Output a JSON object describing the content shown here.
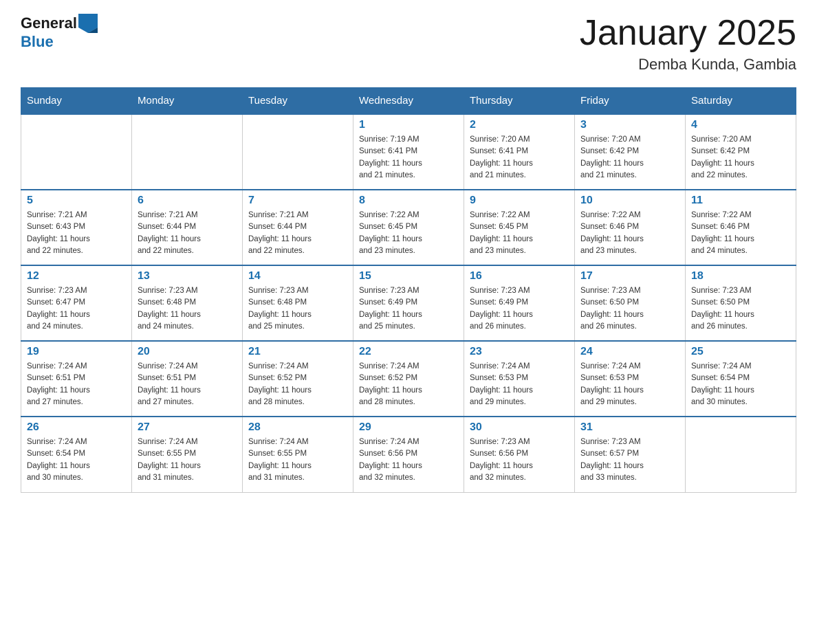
{
  "header": {
    "logo": {
      "general": "General",
      "blue": "Blue",
      "aria": "GeneralBlue logo"
    },
    "title": "January 2025",
    "subtitle": "Demba Kunda, Gambia"
  },
  "days_of_week": [
    "Sunday",
    "Monday",
    "Tuesday",
    "Wednesday",
    "Thursday",
    "Friday",
    "Saturday"
  ],
  "weeks": [
    [
      {
        "day": "",
        "info": ""
      },
      {
        "day": "",
        "info": ""
      },
      {
        "day": "",
        "info": ""
      },
      {
        "day": "1",
        "info": "Sunrise: 7:19 AM\nSunset: 6:41 PM\nDaylight: 11 hours\nand 21 minutes."
      },
      {
        "day": "2",
        "info": "Sunrise: 7:20 AM\nSunset: 6:41 PM\nDaylight: 11 hours\nand 21 minutes."
      },
      {
        "day": "3",
        "info": "Sunrise: 7:20 AM\nSunset: 6:42 PM\nDaylight: 11 hours\nand 21 minutes."
      },
      {
        "day": "4",
        "info": "Sunrise: 7:20 AM\nSunset: 6:42 PM\nDaylight: 11 hours\nand 22 minutes."
      }
    ],
    [
      {
        "day": "5",
        "info": "Sunrise: 7:21 AM\nSunset: 6:43 PM\nDaylight: 11 hours\nand 22 minutes."
      },
      {
        "day": "6",
        "info": "Sunrise: 7:21 AM\nSunset: 6:44 PM\nDaylight: 11 hours\nand 22 minutes."
      },
      {
        "day": "7",
        "info": "Sunrise: 7:21 AM\nSunset: 6:44 PM\nDaylight: 11 hours\nand 22 minutes."
      },
      {
        "day": "8",
        "info": "Sunrise: 7:22 AM\nSunset: 6:45 PM\nDaylight: 11 hours\nand 23 minutes."
      },
      {
        "day": "9",
        "info": "Sunrise: 7:22 AM\nSunset: 6:45 PM\nDaylight: 11 hours\nand 23 minutes."
      },
      {
        "day": "10",
        "info": "Sunrise: 7:22 AM\nSunset: 6:46 PM\nDaylight: 11 hours\nand 23 minutes."
      },
      {
        "day": "11",
        "info": "Sunrise: 7:22 AM\nSunset: 6:46 PM\nDaylight: 11 hours\nand 24 minutes."
      }
    ],
    [
      {
        "day": "12",
        "info": "Sunrise: 7:23 AM\nSunset: 6:47 PM\nDaylight: 11 hours\nand 24 minutes."
      },
      {
        "day": "13",
        "info": "Sunrise: 7:23 AM\nSunset: 6:48 PM\nDaylight: 11 hours\nand 24 minutes."
      },
      {
        "day": "14",
        "info": "Sunrise: 7:23 AM\nSunset: 6:48 PM\nDaylight: 11 hours\nand 25 minutes."
      },
      {
        "day": "15",
        "info": "Sunrise: 7:23 AM\nSunset: 6:49 PM\nDaylight: 11 hours\nand 25 minutes."
      },
      {
        "day": "16",
        "info": "Sunrise: 7:23 AM\nSunset: 6:49 PM\nDaylight: 11 hours\nand 26 minutes."
      },
      {
        "day": "17",
        "info": "Sunrise: 7:23 AM\nSunset: 6:50 PM\nDaylight: 11 hours\nand 26 minutes."
      },
      {
        "day": "18",
        "info": "Sunrise: 7:23 AM\nSunset: 6:50 PM\nDaylight: 11 hours\nand 26 minutes."
      }
    ],
    [
      {
        "day": "19",
        "info": "Sunrise: 7:24 AM\nSunset: 6:51 PM\nDaylight: 11 hours\nand 27 minutes."
      },
      {
        "day": "20",
        "info": "Sunrise: 7:24 AM\nSunset: 6:51 PM\nDaylight: 11 hours\nand 27 minutes."
      },
      {
        "day": "21",
        "info": "Sunrise: 7:24 AM\nSunset: 6:52 PM\nDaylight: 11 hours\nand 28 minutes."
      },
      {
        "day": "22",
        "info": "Sunrise: 7:24 AM\nSunset: 6:52 PM\nDaylight: 11 hours\nand 28 minutes."
      },
      {
        "day": "23",
        "info": "Sunrise: 7:24 AM\nSunset: 6:53 PM\nDaylight: 11 hours\nand 29 minutes."
      },
      {
        "day": "24",
        "info": "Sunrise: 7:24 AM\nSunset: 6:53 PM\nDaylight: 11 hours\nand 29 minutes."
      },
      {
        "day": "25",
        "info": "Sunrise: 7:24 AM\nSunset: 6:54 PM\nDaylight: 11 hours\nand 30 minutes."
      }
    ],
    [
      {
        "day": "26",
        "info": "Sunrise: 7:24 AM\nSunset: 6:54 PM\nDaylight: 11 hours\nand 30 minutes."
      },
      {
        "day": "27",
        "info": "Sunrise: 7:24 AM\nSunset: 6:55 PM\nDaylight: 11 hours\nand 31 minutes."
      },
      {
        "day": "28",
        "info": "Sunrise: 7:24 AM\nSunset: 6:55 PM\nDaylight: 11 hours\nand 31 minutes."
      },
      {
        "day": "29",
        "info": "Sunrise: 7:24 AM\nSunset: 6:56 PM\nDaylight: 11 hours\nand 32 minutes."
      },
      {
        "day": "30",
        "info": "Sunrise: 7:23 AM\nSunset: 6:56 PM\nDaylight: 11 hours\nand 32 minutes."
      },
      {
        "day": "31",
        "info": "Sunrise: 7:23 AM\nSunset: 6:57 PM\nDaylight: 11 hours\nand 33 minutes."
      },
      {
        "day": "",
        "info": ""
      }
    ]
  ]
}
